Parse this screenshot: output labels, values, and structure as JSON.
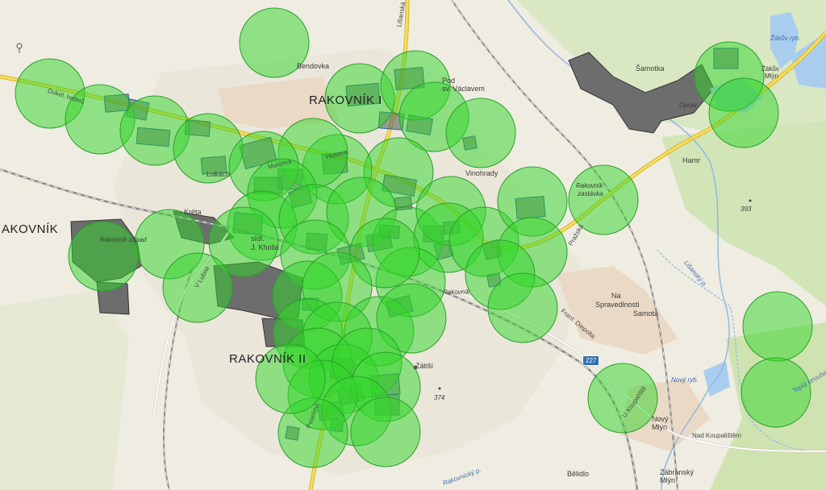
{
  "map": {
    "labels": {
      "rakovnik_i": "RAKOVNÍK I",
      "rakovnik_ii": "RAKOVNÍK II",
      "rakovnik_edge": "AKOVNÍK",
      "bendovka": "Bendovka",
      "samotka": "Šamotka",
      "pod_svatym_vaclavem_1": "Pod",
      "pod_svatym_vaclavem_2": "sv. Václavem",
      "vinohrady": "Vinohrady",
      "hamr": "Hamr",
      "na_spravedlnosti_1": "Na",
      "na_spravedlnosti_2": "Spravedlnosti",
      "samota": "Samota",
      "zatisi": "Zátiší",
      "novy_mlyn_1": "Nový",
      "novy_mlyn_2": "Mlýn",
      "zabransky_mlyn_1": "Zábranský",
      "zabransky_mlyn_2": "Mlýn",
      "belidlo": "Bělidlo",
      "zakuv_rybnik": "Žákův ryb.",
      "zakuv_mlyn_1": "Žákův",
      "zakuv_mlyn_2": "Mlýn",
      "novy_rybnik": "Nový ryb.",
      "rakovnicky_potok": "Rakovnický p.",
      "lisansky_potok": "Lišanský p.",
      "zastavka_1": "Rakovník",
      "zastavka_2": "zastávka",
      "zastavka_3": "zastávka",
      "rakovnik_zapad": "Rakovník západ",
      "rakovnik_station": "Rakovník",
      "opravarna": "Oprav.",
      "kreta": "Kréta",
      "sidliste": "sídl.",
      "j_kholla": "J. Kholla",
      "lukach": "Lukách",
      "malcova": "Malcova"
    },
    "roads": {
      "dukel_hrdinu": "Dukel. hrdinů",
      "lisanska": "Lišanská",
      "husova": "Husova",
      "lubenska": "V Lubné",
      "prazska": "Pražská",
      "frant_diepolta": "Frant. Diepolta",
      "nad_koupalistem": "Nad Koupalištěm",
      "u_koupaliste": "U Koupaliště",
      "poselstvi": "Poselství",
      "teplec": "Teplá strouha"
    },
    "elevations": {
      "e393": "393",
      "e374": "374"
    },
    "shield_227": "227",
    "colors": {
      "background": "#efece1",
      "coverage_circle": "#31d62a",
      "circle_stroke": "#2aa02a",
      "building_block": "#4c5a55",
      "grey_area": "#6d6d6d",
      "water": "#a9cdee",
      "forest": "#cfe3b0",
      "road_major": "#f3d44b",
      "rail": "#8b8b8b"
    }
  }
}
